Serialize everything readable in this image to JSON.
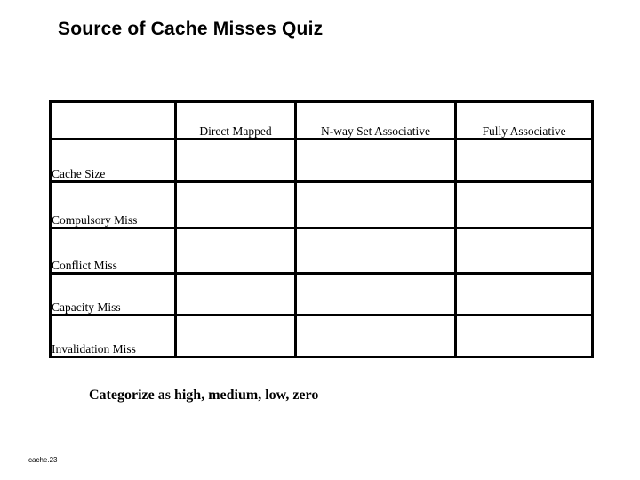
{
  "slide": {
    "title": "Source of Cache Misses Quiz",
    "caption": "Categorize as high, medium, low, zero",
    "footer": "cache.23",
    "background_color": "#ffffff",
    "text_color": "#000000",
    "border_color": "#000000"
  },
  "table": {
    "corner_label": "",
    "columns": [
      {
        "key": "direct_mapped",
        "label": "Direct Mapped"
      },
      {
        "key": "n_way_set_associative",
        "label": "N-way Set Associative"
      },
      {
        "key": "fully_associative",
        "label": "Fully Associative"
      }
    ],
    "rows": [
      {
        "label": "Cache Size",
        "direct_mapped": "",
        "n_way_set_associative": "",
        "fully_associative": ""
      },
      {
        "label": "Compulsory Miss",
        "direct_mapped": "",
        "n_way_set_associative": "",
        "fully_associative": ""
      },
      {
        "label": "Conflict Miss",
        "direct_mapped": "",
        "n_way_set_associative": "",
        "fully_associative": ""
      },
      {
        "label": "Capacity  Miss",
        "direct_mapped": "",
        "n_way_set_associative": "",
        "fully_associative": ""
      },
      {
        "label": "Invalidation  Miss",
        "direct_mapped": "",
        "n_way_set_associative": "",
        "fully_associative": ""
      }
    ]
  }
}
